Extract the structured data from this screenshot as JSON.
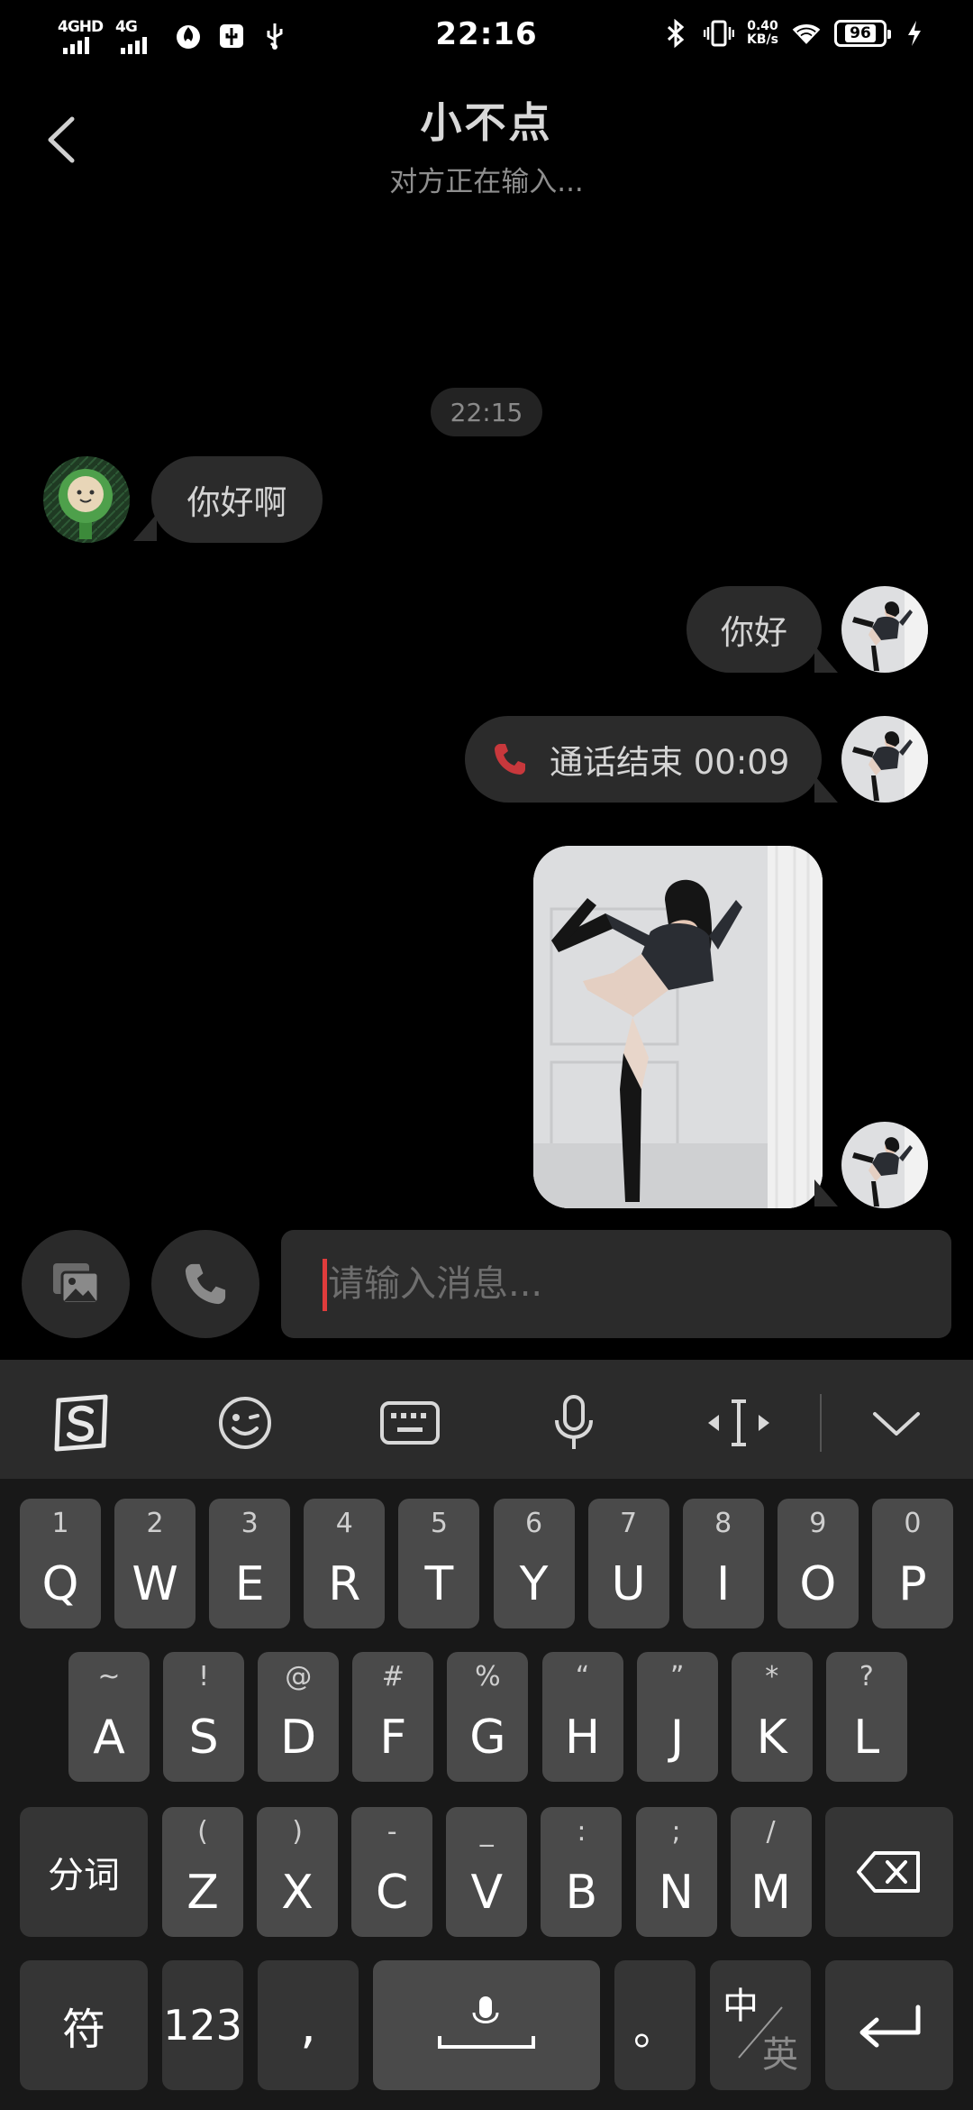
{
  "status_bar": {
    "network_1": "4GHD",
    "network_2": "4G",
    "time": "22:16",
    "speed_value": "0.40",
    "speed_unit": "KB/s",
    "battery": "96"
  },
  "header": {
    "title": "小不点",
    "subtitle": "对方正在输入..."
  },
  "chat": {
    "timestamp": "22:15",
    "messages": [
      {
        "side": "left",
        "type": "text",
        "text": "你好啊"
      },
      {
        "side": "right",
        "type": "text",
        "text": "你好"
      },
      {
        "side": "right",
        "type": "call",
        "text": "通话结束 00:09"
      },
      {
        "side": "right",
        "type": "image"
      }
    ]
  },
  "input": {
    "placeholder": "请输入消息..."
  },
  "keyboard": {
    "row1": [
      {
        "sub": "1",
        "main": "Q"
      },
      {
        "sub": "2",
        "main": "W"
      },
      {
        "sub": "3",
        "main": "E"
      },
      {
        "sub": "4",
        "main": "R"
      },
      {
        "sub": "5",
        "main": "T"
      },
      {
        "sub": "6",
        "main": "Y"
      },
      {
        "sub": "7",
        "main": "U"
      },
      {
        "sub": "8",
        "main": "I"
      },
      {
        "sub": "9",
        "main": "O"
      },
      {
        "sub": "0",
        "main": "P"
      }
    ],
    "row2": [
      {
        "sub": "~",
        "main": "A"
      },
      {
        "sub": "!",
        "main": "S"
      },
      {
        "sub": "@",
        "main": "D"
      },
      {
        "sub": "#",
        "main": "F"
      },
      {
        "sub": "%",
        "main": "G"
      },
      {
        "sub": "“",
        "main": "H"
      },
      {
        "sub": "”",
        "main": "J"
      },
      {
        "sub": "*",
        "main": "K"
      },
      {
        "sub": "?",
        "main": "L"
      }
    ],
    "row3": [
      {
        "sub": "(",
        "main": "Z"
      },
      {
        "sub": ")",
        "main": "X"
      },
      {
        "sub": "-",
        "main": "C"
      },
      {
        "sub": "_",
        "main": "V"
      },
      {
        "sub": ":",
        "main": "B"
      },
      {
        "sub": ";",
        "main": "N"
      },
      {
        "sub": "/",
        "main": "M"
      }
    ],
    "segment_key": "分词",
    "symbol_key": "符",
    "number_key": "123",
    "comma_key": ",",
    "period_key": "。",
    "lang_top": "中",
    "lang_bottom": "英"
  }
}
